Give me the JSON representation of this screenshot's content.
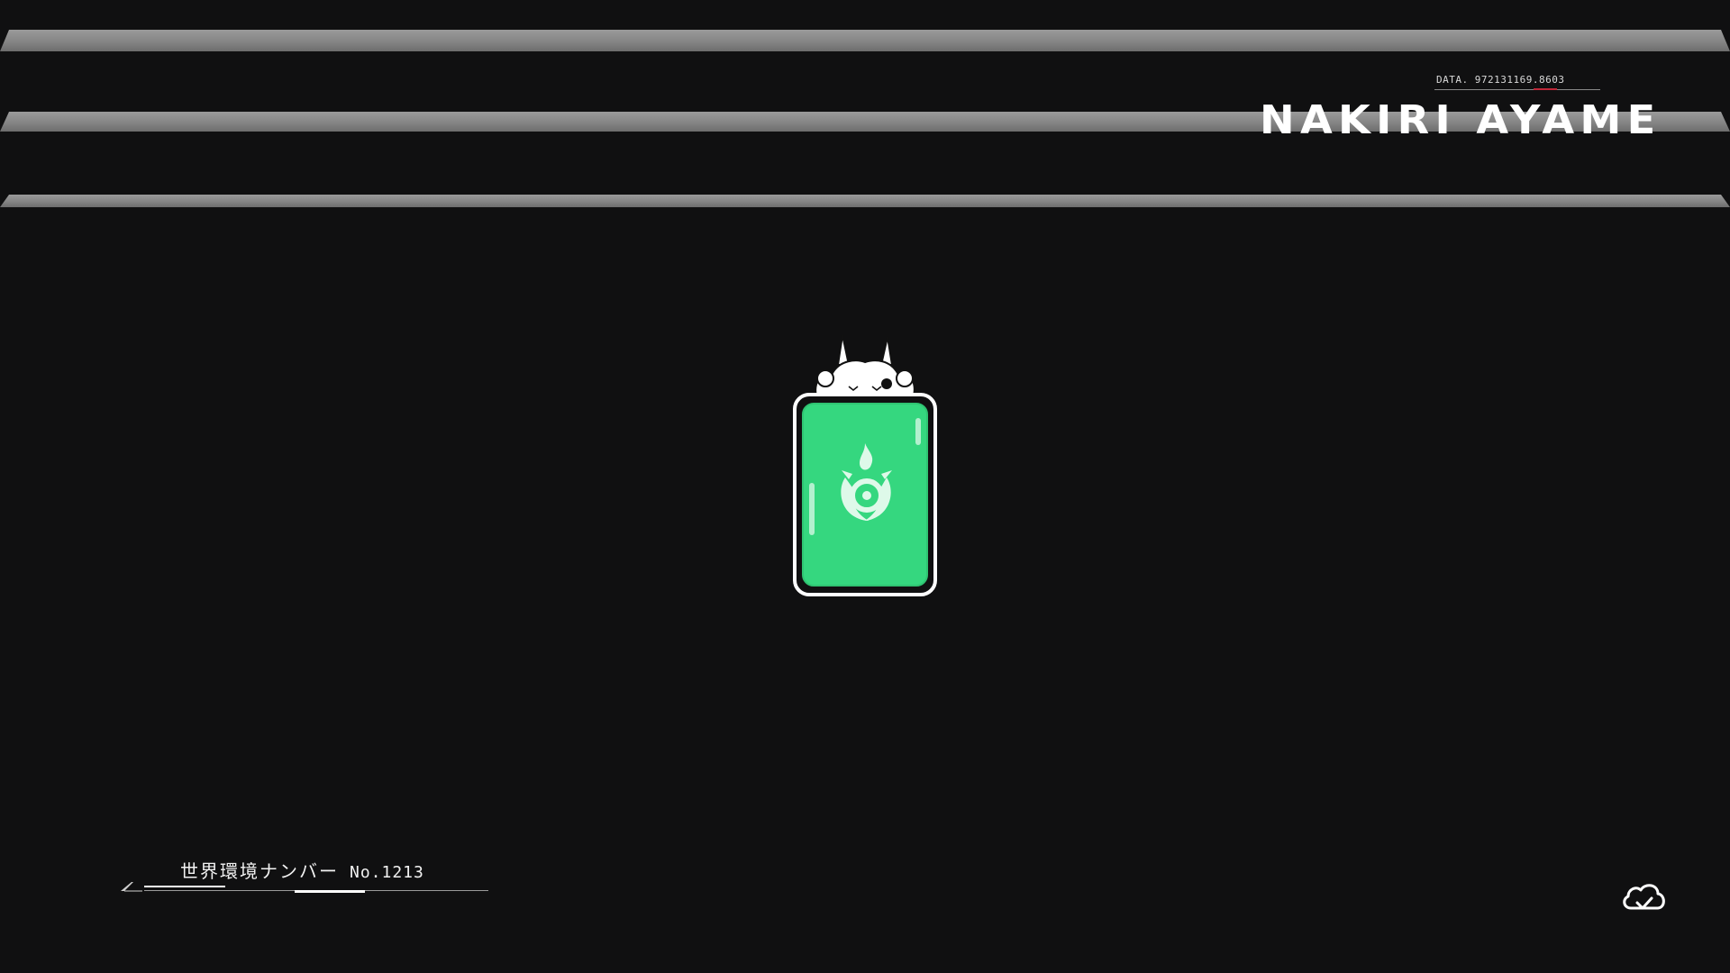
{
  "header": {
    "data_readout": "DATA. 972131169.8603",
    "brand_title": "NAKIRI AYAME"
  },
  "loading": {
    "mascot_icon": "oni-mascot-icon",
    "emblem_icon": "anemo-emblem-icon",
    "card_color": "#35d77f"
  },
  "world": {
    "label": "世界環境ナンバー",
    "number": "No.1213"
  },
  "status": {
    "cloud_icon": "cloud-check-icon"
  },
  "colors": {
    "background": "#101011",
    "stripe": "#8a8a8a",
    "accent_red": "#c0283a"
  }
}
